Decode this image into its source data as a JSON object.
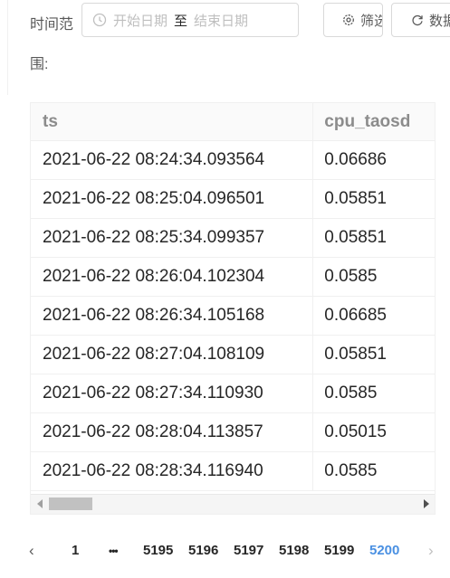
{
  "filter": {
    "label": "时间范围:",
    "start_placeholder": "开始日期",
    "separator": "至",
    "end_placeholder": "结束日期",
    "filter_button": "筛选条件",
    "refresh_button": "数据刷新"
  },
  "table": {
    "columns": [
      "ts",
      "cpu_taosd"
    ],
    "rows": [
      [
        "2021-06-22 08:24:34.093564",
        "0.06686"
      ],
      [
        "2021-06-22 08:25:04.096501",
        "0.05851"
      ],
      [
        "2021-06-22 08:25:34.099357",
        "0.05851"
      ],
      [
        "2021-06-22 08:26:04.102304",
        "0.0585"
      ],
      [
        "2021-06-22 08:26:34.105168",
        "0.06685"
      ],
      [
        "2021-06-22 08:27:04.108109",
        "0.05851"
      ],
      [
        "2021-06-22 08:27:34.110930",
        "0.0585"
      ],
      [
        "2021-06-22 08:28:04.113857",
        "0.05015"
      ],
      [
        "2021-06-22 08:28:34.116940",
        "0.0585"
      ]
    ]
  },
  "pagination": {
    "prev": "‹",
    "first": "1",
    "ellipsis": "•••",
    "pages": [
      "5195",
      "5196",
      "5197",
      "5198",
      "5199",
      "5200"
    ],
    "current": "5200",
    "next": "›"
  }
}
